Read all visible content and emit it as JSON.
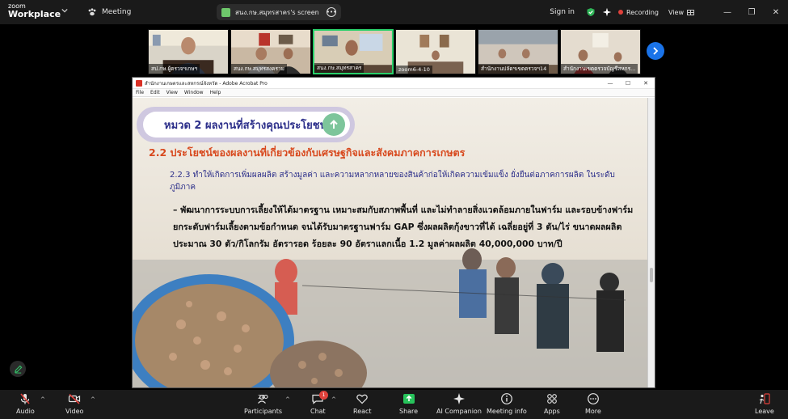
{
  "app": {
    "logo_line1": "zoom",
    "logo_line2": "Workplace"
  },
  "topbar": {
    "meeting_label": "Meeting",
    "share_label": "สนง.กษ.สมุทรสาคร's screen",
    "signin_label": "Sign in",
    "recording_label": "Recording",
    "view_label": "View",
    "accent_green": "#29d06a",
    "recording_color": "#e0413b"
  },
  "gallery": {
    "tiles": [
      {
        "name": "สป.กษ.ผู้ตรวจฯเกษฯ",
        "active": false
      },
      {
        "name": "สนง.กษ.สมุทรสงคราม",
        "active": false
      },
      {
        "name": "สนง.กษ.สมุทรสาคร",
        "active": true
      },
      {
        "name": "zoom6-4-10",
        "active": false
      },
      {
        "name": "สำนักงานปลัดฯเขตตรวจฯ14",
        "active": false
      },
      {
        "name": "สำนักงานเขตตรวจบัญชีสหกร...",
        "active": false
      }
    ]
  },
  "acrobat": {
    "title": "สำนักงานเกษตรและสหกรณ์จังหวัด - Adobe Acrobat Pro",
    "menu": [
      "File",
      "Edit",
      "View",
      "Window",
      "Help"
    ],
    "win_min": "—",
    "win_max": "☐",
    "win_close": "✕"
  },
  "slide": {
    "heading": "หมวด 2 ผลงานที่สร้างคุณประโยชน์",
    "section_title": "2.2 ประโยชน์ของผลงานที่เกี่ยวข้องกับเศรษฐกิจและสังคมภาคการเกษตร",
    "subtitle": "2.2.3 ทำให้เกิดการเพิ่มผลผลิต สร้างมูลค่า และความหลากหลายของสินค้าก่อให้เกิดความเข้มแข็ง ยั่งยืนต่อภาคการผลิต ในระดับภูมิภาค",
    "body": "– พัฒนาการระบบการเลี้ยงให้ได้มาตรฐาน เหมาะสมกับสภาพพื้นที่ และไม่ทำลายสิ่งแวดล้อมภายในฟาร์ม และรอบข้างฟาร์ม ยกระดับฟาร์มเลี้ยงตามข้อกำหนด จนได้รับมาตรฐานฟาร์ม GAP ซึ่งผลผลิตกุ้งขาวที่ได้ เฉลี่ยอยู่ที่ 3 ตัน/ไร่ ขนาดผลผลิต ประมาณ 30 ตัว/กิโลกรัม อัตรารอด ร้อยละ 90 อัตราแลกเนื้อ 1.2 มูลค่าผลผลิต 40,000,000 บาท/ปี"
  },
  "toolbar": {
    "audio": "Audio",
    "video": "Video",
    "participants": "Participants",
    "participants_count": "24",
    "chat": "Chat",
    "chat_badge": "1",
    "react": "React",
    "share": "Share",
    "ai_companion": "AI Companion",
    "meeting_info": "Meeting info",
    "apps": "Apps",
    "more": "More",
    "leave": "Leave",
    "share_color": "#27c35b",
    "muted_color": "#e0413b"
  }
}
